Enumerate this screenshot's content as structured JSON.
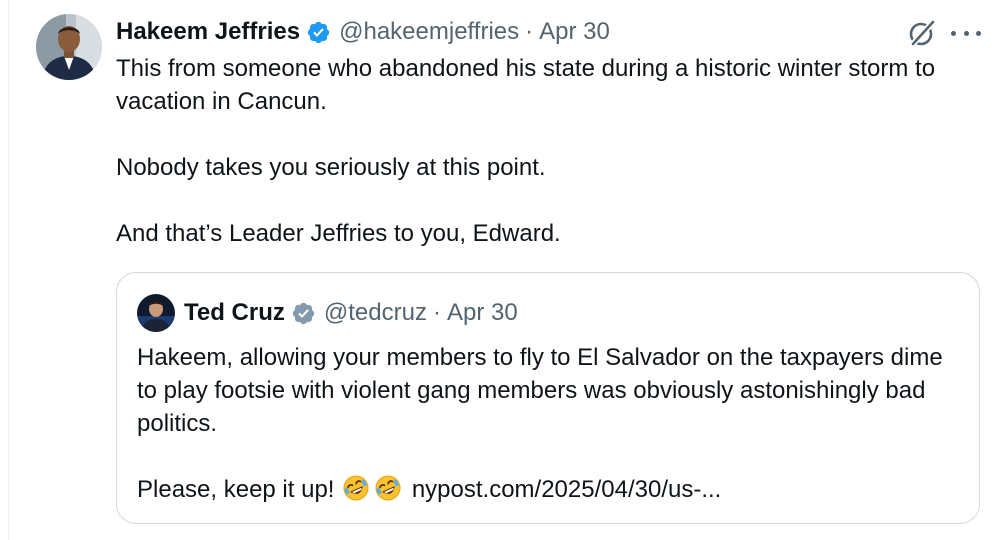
{
  "tweet": {
    "author_name": "Hakeem Jeffries",
    "handle": "@hakeemjeffries",
    "separator": "·",
    "date": "Apr 30",
    "verified_color": "#1d9bf0",
    "icons": {
      "grok": "grok-icon",
      "more": "more-options-icon",
      "verified": "verified-badge-icon"
    },
    "text_lines": [
      "This from someone who abandoned his state during a historic winter storm to vacation in Cancun.",
      "Nobody takes you seriously at this point.",
      "And that’s Leader Jeffries to you, Edward."
    ]
  },
  "quoted_tweet": {
    "author_name": "Ted Cruz",
    "handle": "@tedcruz",
    "separator": "·",
    "date": "Apr 30",
    "verified_color": "#829aab",
    "text_lines": [
      "Hakeem, allowing your members to fly to El Salvador on the taxpayers dime to play footsie with violent gang members was obviously astonishingly bad politics.",
      "Please, keep it up!"
    ],
    "emoji": [
      "rolling-on-floor-laughing",
      "rolling-on-floor-laughing"
    ],
    "link_text": "nypost.com/2025/04/30/us-..."
  }
}
